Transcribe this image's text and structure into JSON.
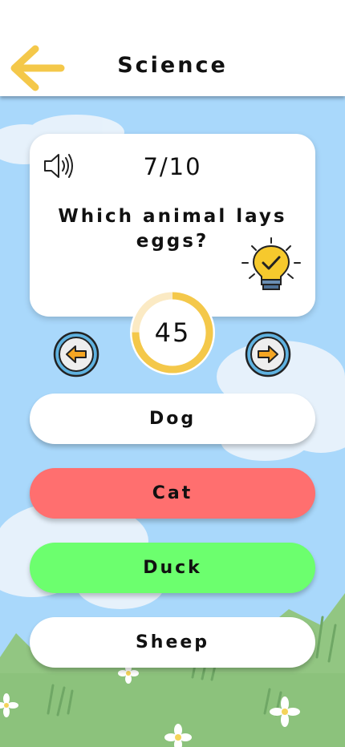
{
  "header": {
    "title": "Science"
  },
  "quiz": {
    "counter": "7/10",
    "question": "Which animal lays eggs?",
    "timer_value": "45",
    "timer_progress": 0.75
  },
  "answers": [
    {
      "label": "Dog",
      "state": "default",
      "color": "#ffffff"
    },
    {
      "label": "Cat",
      "state": "wrong",
      "color": "#ff6f6f"
    },
    {
      "label": "Duck",
      "state": "correct",
      "color": "#6cff6e"
    },
    {
      "label": "Sheep",
      "state": "default",
      "color": "#ffffff"
    }
  ],
  "icons": {
    "back": "arrow-left-icon",
    "sound": "speaker-icon",
    "hint": "lightbulb-icon",
    "prev": "arrow-left-circle-icon",
    "next": "arrow-right-circle-icon"
  },
  "colors": {
    "accent": "#f4c84a",
    "sky": "#a9d8fb",
    "grass": "#8cc27c",
    "wrong": "#ff6f6f",
    "correct": "#6cff6e"
  }
}
